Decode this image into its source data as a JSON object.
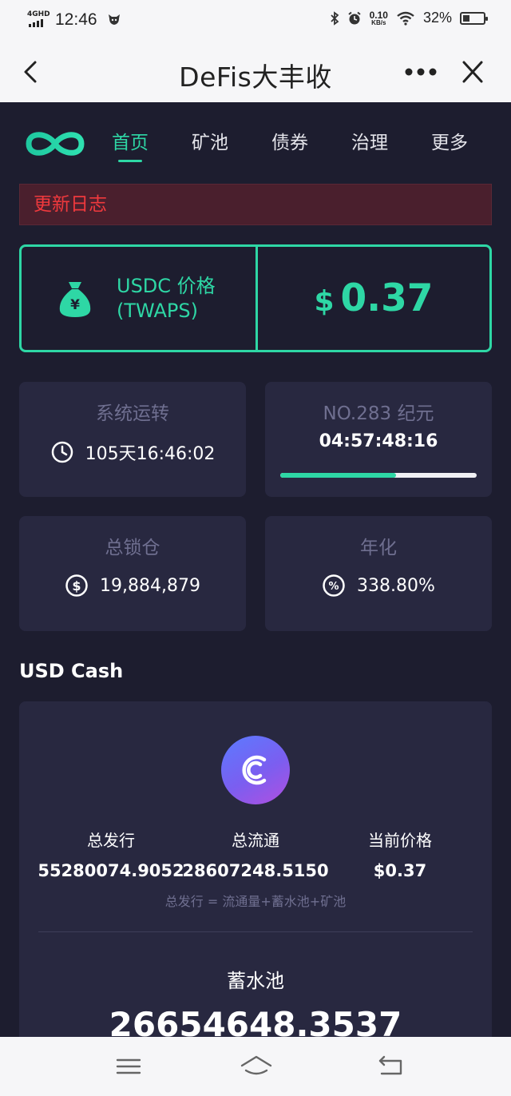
{
  "status_bar": {
    "network": "4GHD",
    "time": "12:46",
    "speed_value": "0.10",
    "speed_unit": "KB/s",
    "battery": "32%",
    "battery_level_percent": 32
  },
  "title_bar": {
    "title": "DeFis大丰收",
    "back_icon": "chevron-left-icon",
    "more_icon": "more-dots-icon",
    "close_icon": "close-icon"
  },
  "nav": {
    "logo_icon": "infinity-logo-icon",
    "items": [
      {
        "label": "首页",
        "active": true
      },
      {
        "label": "矿池",
        "active": false
      },
      {
        "label": "债券",
        "active": false
      },
      {
        "label": "治理",
        "active": false
      },
      {
        "label": "更多",
        "active": false
      }
    ]
  },
  "update_log": "更新日志",
  "price_card": {
    "icon": "money-bag-icon",
    "label_line1": "USDC 价格",
    "label_line2": "(TWAPS)",
    "currency": "$",
    "value": "0.37"
  },
  "stats": {
    "uptime": {
      "title": "系统运转",
      "icon": "clock-icon",
      "value": "105天16:46:02"
    },
    "epoch": {
      "title": "NO.283 纪元",
      "countdown": "04:57:48:16",
      "progress": 0.59
    },
    "tvl": {
      "title": "总锁仓",
      "icon": "dollar-circle-icon",
      "value": "19,884,879"
    },
    "apy": {
      "title": "年化",
      "icon": "percent-circle-icon",
      "value": "338.80%"
    }
  },
  "usd_cash": {
    "heading": "USD Cash",
    "coin_icon": "usd-cash-coin-icon",
    "columns": [
      {
        "label": "总发行",
        "value": "55280074.9052"
      },
      {
        "label": "总流通",
        "value": "28607248.5150"
      },
      {
        "label": "当前价格",
        "value": "$0.37"
      }
    ],
    "note": "总发行 = 流通量+蓄水池+矿池",
    "pool_label": "蓄水池",
    "pool_value": "26654648.3537"
  },
  "bottom_nav": {
    "menu_icon": "menu-icon",
    "home_icon": "home-icon",
    "back_icon": "back-icon"
  },
  "colors": {
    "accent": "#2ed7a5",
    "background": "#1d1d2f",
    "card": "#282840",
    "danger": "#f0393d",
    "muted": "#6f6f90"
  }
}
